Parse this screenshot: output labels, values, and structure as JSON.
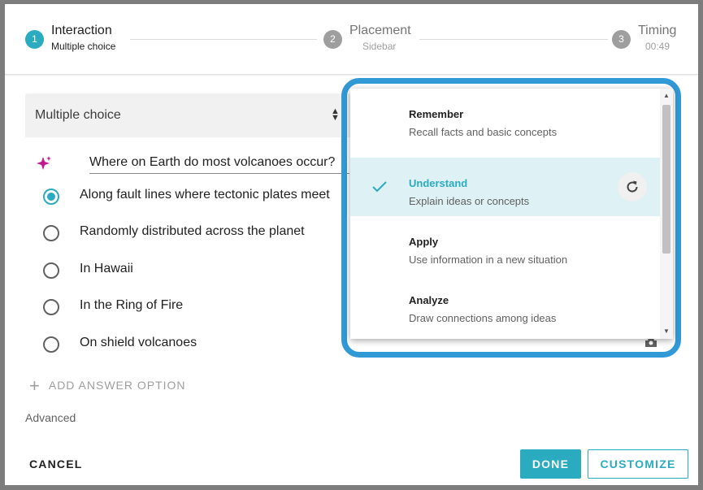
{
  "stepper": {
    "steps": [
      {
        "number": "1",
        "title": "Interaction",
        "subtitle": "Multiple choice",
        "state": "active"
      },
      {
        "number": "2",
        "title": "Placement",
        "subtitle": "Sidebar",
        "state": "inactive"
      },
      {
        "number": "3",
        "title": "Timing",
        "subtitle": "00:49",
        "state": "inactive"
      }
    ]
  },
  "interaction_type": {
    "value": "Multiple choice"
  },
  "question": {
    "value": "Where on Earth do most volcanoes occur?"
  },
  "answers": [
    {
      "label": "Along fault lines where tectonic plates meet",
      "selected": true
    },
    {
      "label": "Randomly distributed across the planet",
      "selected": false
    },
    {
      "label": "In Hawaii",
      "selected": false
    },
    {
      "label": "In the Ring of Fire",
      "selected": false
    },
    {
      "label": "On shield volcanoes",
      "selected": false
    }
  ],
  "add_answer_label": "ADD ANSWER OPTION",
  "advanced_label": "Advanced",
  "footer": {
    "cancel_label": "CANCEL",
    "done_label": "DONE",
    "customize_label": "CUSTOMIZE"
  },
  "dropdown": {
    "options": [
      {
        "title": "Remember",
        "description": "Recall facts and basic concepts",
        "selected": false
      },
      {
        "title": "Understand",
        "description": "Explain ideas or concepts",
        "selected": true
      },
      {
        "title": "Apply",
        "description": "Use information in a new situation",
        "selected": false
      },
      {
        "title": "Analyze",
        "description": "Draw connections among ideas",
        "selected": false
      }
    ]
  },
  "colors": {
    "accent": "#2aabbf",
    "highlight": "#3199d6",
    "inactive_step": "#9e9e9e"
  },
  "icons": [
    "sparkle-icon",
    "check-icon",
    "refresh-icon",
    "plus-icon",
    "sort-arrows-icon",
    "gear-icon"
  ]
}
